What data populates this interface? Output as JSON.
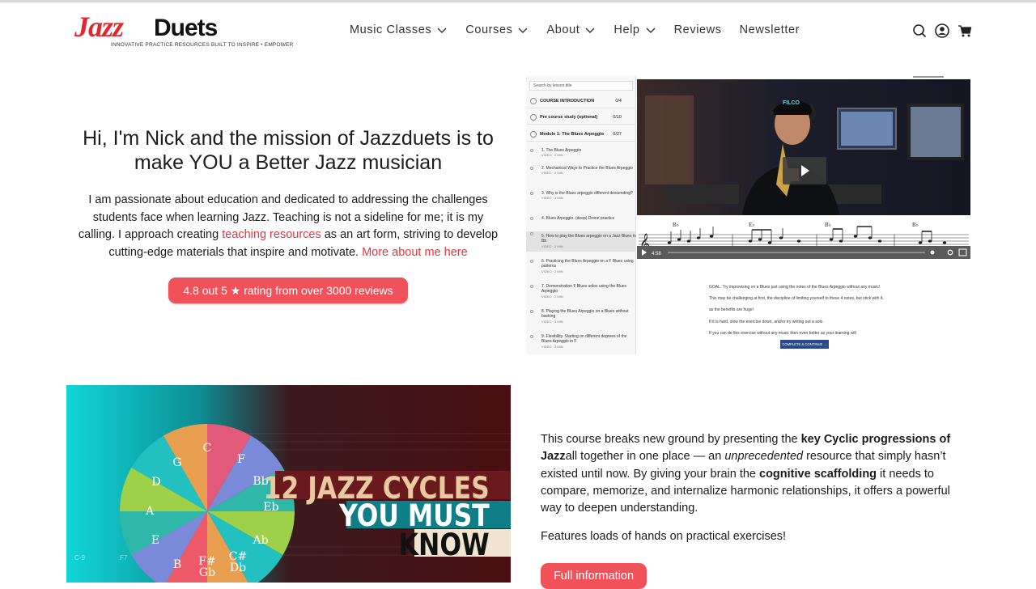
{
  "header": {
    "logo": {
      "jazz": "Jazz",
      "duets": "Duets",
      "tagline": "INNOVATIVE PRACTICE RESOURCES BUILT TO INSPIRE • EMPOWER"
    },
    "nav": [
      {
        "label": "Music Classes",
        "dropdown": true
      },
      {
        "label": "Courses",
        "dropdown": true
      },
      {
        "label": "About",
        "dropdown": true
      },
      {
        "label": "Help",
        "dropdown": true
      },
      {
        "label": "Reviews",
        "dropdown": false
      },
      {
        "label": "Newsletter",
        "dropdown": false
      }
    ],
    "icons": [
      "search-icon",
      "account-icon",
      "cart-icon"
    ]
  },
  "hero": {
    "title_line1": "Hi, I'm Nick and the mission of Jazzduets is to",
    "title_line2": "make YOU a Better Jazz musician",
    "text_part1": "I am passionate about education and dedicated to addressing the challenges students face when learning Jazz. Teaching is not a sideline for me; it is my calling. I approach creating ",
    "text_link": "teaching resources",
    "text_part2": " as an art form, striving to develop cutting-edge materials that inspire and motivate.  ",
    "more_link": "More about me here",
    "rating_button": "4.8 out 5 ★ rating from over 3000 reviews"
  },
  "screenshot": {
    "search_placeholder": "Search by lesson title",
    "sections": [
      {
        "title": "COURSE INTRODUCTION",
        "count": "0/4"
      },
      {
        "title": "Pre course study (optional)",
        "count": "0/10"
      },
      {
        "title": "Module 1: The Blues Arpeggio",
        "count": "0/27"
      }
    ],
    "lessons": [
      {
        "title": "1. The Blues Arpeggio",
        "meta": "VIDEO · 2 MIN"
      },
      {
        "title": "2. Mechanical Ways to Practice the Blues Arpeggio",
        "meta": "VIDEO · 4 MIN"
      },
      {
        "title": "3. Why is the Blues arpeggio different descending?",
        "meta": "VIDEO · 1 MIN"
      },
      {
        "title": "4. Blues Arpeggio. (deep) Drone practice",
        "meta": ""
      },
      {
        "title": "5. How to play the Blues arpeggio on a Jazz Blues in Bb",
        "meta": "VIDEO · 2 MIN"
      },
      {
        "title": "6. Practicing the Blues Arpeggio on a F Blues using patterns",
        "meta": "VIDEO · 2 MIN"
      },
      {
        "title": "7. Demonstration F Blues solos using the Blues Arpeggio",
        "meta": "VIDEO · 2 MIN"
      },
      {
        "title": "8. Playing the Blues Arpeggio on a Blues without backing",
        "meta": "VIDEO · 3 MIN"
      },
      {
        "title": "9. Flexibility. Starting on different degrees of the Blues Arpeggio in F",
        "meta": "VIDEO · 3 MIN"
      }
    ],
    "cap_text": "FILCO",
    "chords": [
      "B♭",
      "E♭",
      "B♭",
      "B♭"
    ],
    "time": "4:58",
    "desc_lines": [
      "GOAL.  Try improvising on a Blues  just using the notes of the Blues Arpeggio without any music!",
      "This may be challenging at first, the discipline of limiting yourself to these 4 notes, but stick with it,",
      "as the benefits are huge!",
      "If it is hard, slow the exercise down, and/or try writing out a solo.",
      "If you can do this exercise without any music then even better as your learning will"
    ],
    "complete_button": "COMPLETE & CONTINUE  →"
  },
  "banner": {
    "wheel_notes": [
      "C",
      "F",
      "Bb",
      "Eb",
      "Ab",
      "C#\nDb",
      "F#\nGb",
      "B",
      "E",
      "A",
      "D",
      "G"
    ],
    "line1": "12 JAZZ CYCLES",
    "line2": "YOU MUST",
    "line3": "KNOW",
    "small_labels": [
      "C-9",
      "F7",
      "F-9"
    ]
  },
  "course": {
    "p1_a": "This course breaks new ground by presenting the ",
    "p1_b": "key Cyclic progressions of Jazz",
    "p1_c": "all together in one place — an ",
    "p1_d": "unprecedented",
    "p1_e": " resource that simply hasn’t existed until now. By giving your brain the ",
    "p1_f": "cognitive scaffolding",
    "p1_g": " it needs to compare, memorize, and internalize harmonic relationships, it offers a powerful way to deepen understanding.",
    "p2": "Features loads of hands on practical exercises!",
    "button": "Full information"
  },
  "colors": {
    "accent": "#f1525a",
    "link": "#e0393f",
    "logo_red": "#e0282f",
    "teal": "#1fb5b5"
  }
}
